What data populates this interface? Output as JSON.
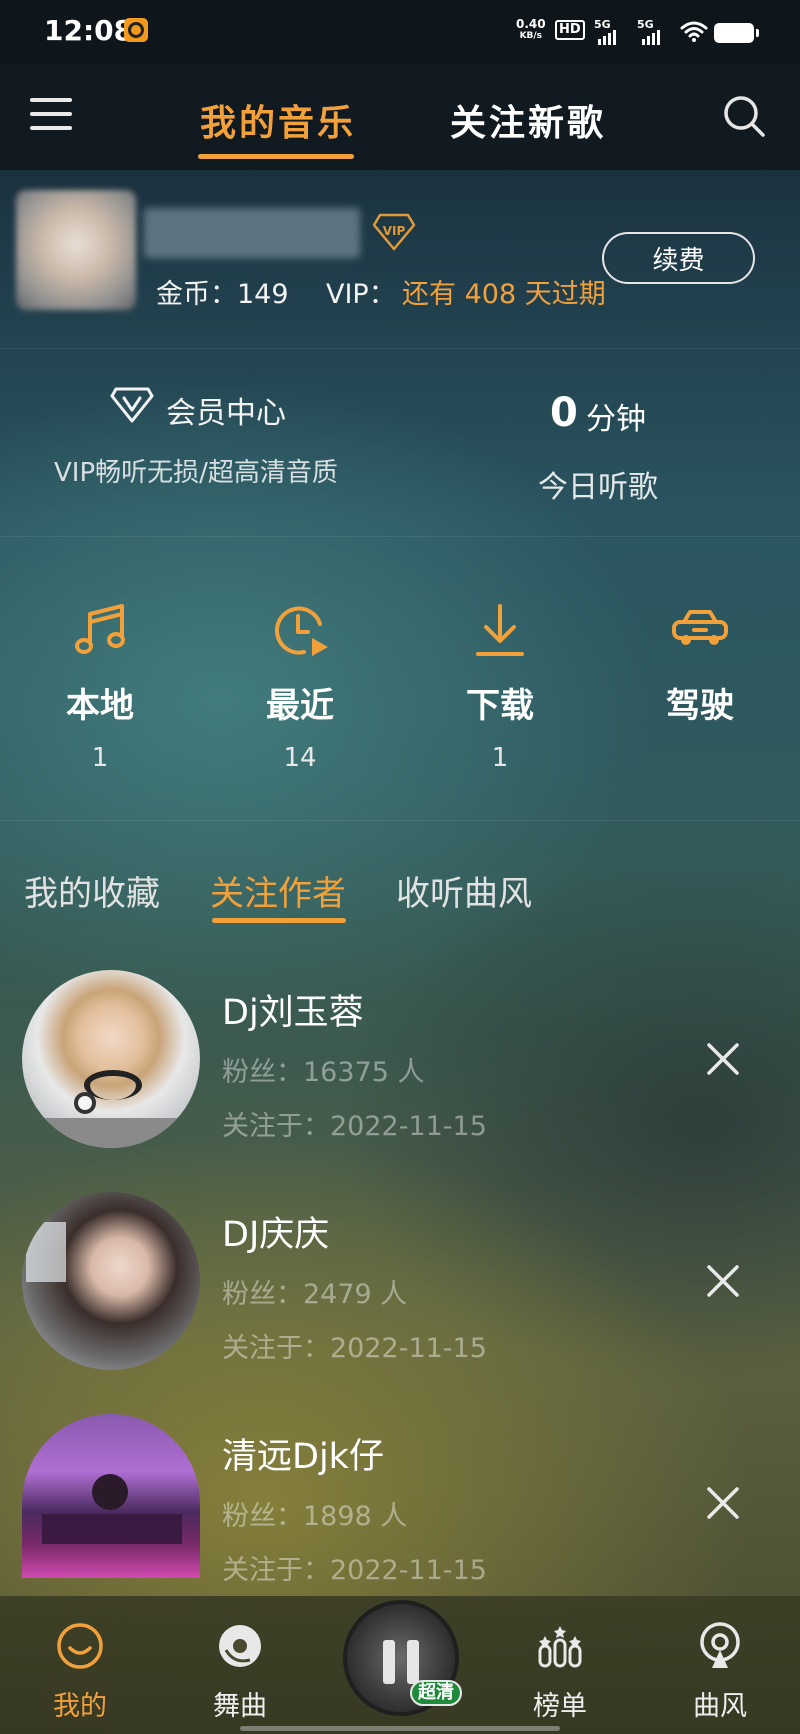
{
  "status_bar": {
    "time": "12:08",
    "net_speed_value": "0.40",
    "net_speed_unit": "KB/s",
    "hd_label": "HD",
    "sim1_label": "5G",
    "sim2_label": "5G"
  },
  "header": {
    "tabs": [
      {
        "label": "我的音乐",
        "active": true
      },
      {
        "label": "关注新歌",
        "active": false
      }
    ]
  },
  "profile": {
    "coins_text": "金币：149",
    "vip_label": "VIP：",
    "vip_expiry_text": "还有 408 天过期",
    "vip_badge_text": "VIP",
    "renew_label": "续费"
  },
  "member": {
    "title": "会员中心",
    "subtitle": "VIP畅听无损/超高清音质",
    "minutes_value": "0",
    "minutes_unit": "分钟",
    "today_label": "今日听歌"
  },
  "quick_entries": [
    {
      "label": "本地",
      "count": "1",
      "icon": "music-note-icon"
    },
    {
      "label": "最近",
      "count": "14",
      "icon": "clock-play-icon"
    },
    {
      "label": "下载",
      "count": "1",
      "icon": "download-icon"
    },
    {
      "label": "驾驶",
      "count": "",
      "icon": "car-icon"
    }
  ],
  "sub_tabs": [
    {
      "label": "我的收藏",
      "active": false
    },
    {
      "label": "关注作者",
      "active": true
    },
    {
      "label": "收听曲风",
      "active": false
    }
  ],
  "follows": [
    {
      "name": "Dj刘玉蓉",
      "fans": "粉丝：16375 人",
      "followed": "关注于：2022-11-15"
    },
    {
      "name": "DJ庆庆",
      "fans": "粉丝：2479 人",
      "followed": "关注于：2022-11-15"
    },
    {
      "name": "清远Djk仔",
      "fans": "粉丝：1898 人",
      "followed": "关注于：2022-11-15"
    }
  ],
  "bottom_nav": [
    {
      "label": "我的",
      "active": true
    },
    {
      "label": "舞曲",
      "active": false
    },
    {
      "label": "榜单",
      "active": false
    },
    {
      "label": "曲风",
      "active": false
    }
  ],
  "player": {
    "quality_badge": "超清"
  },
  "colors": {
    "accent": "#f2a03a",
    "header_bg": "#111a20"
  }
}
